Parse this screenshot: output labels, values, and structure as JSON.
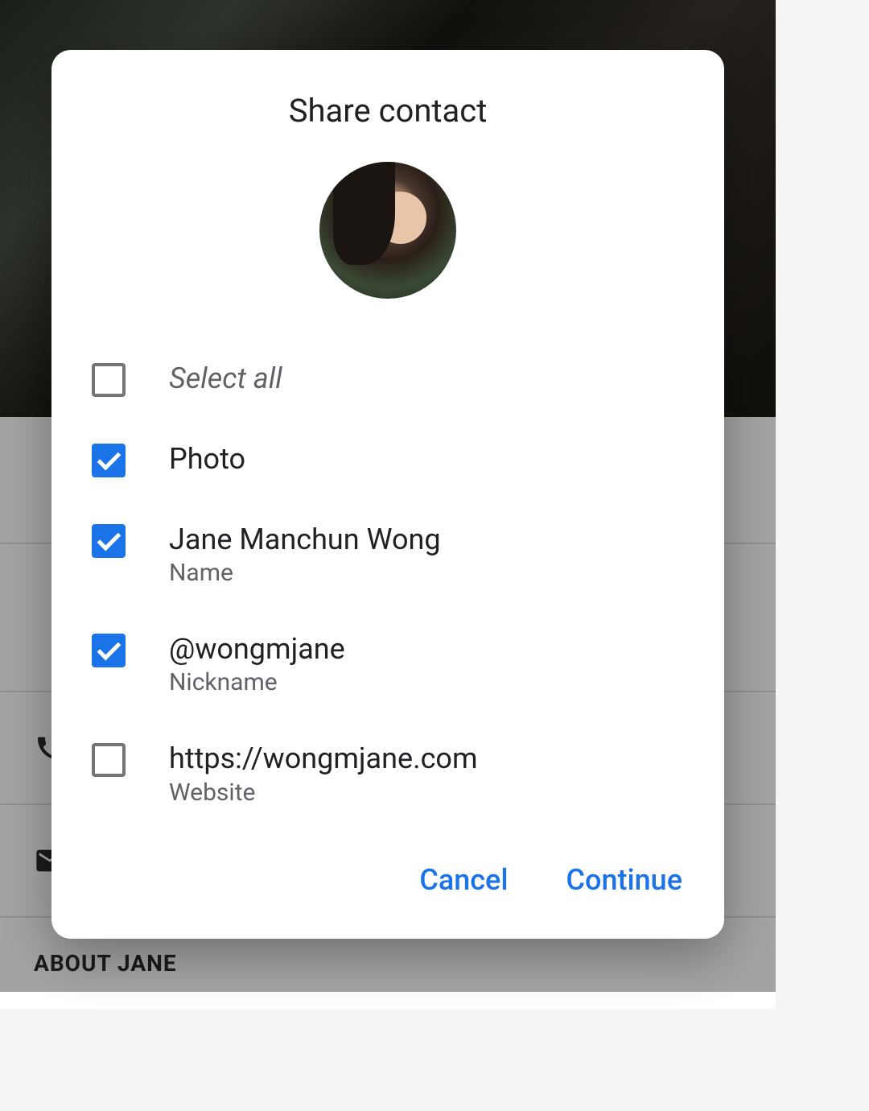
{
  "background": {
    "section_label": "ABOUT JANE"
  },
  "modal": {
    "title": "Share contact",
    "select_all_label": "Select all",
    "items": [
      {
        "primary": "Photo",
        "secondary": null,
        "checked": true
      },
      {
        "primary": "Jane Manchun Wong",
        "secondary": "Name",
        "checked": true
      },
      {
        "primary": "@wongmjane",
        "secondary": "Nickname",
        "checked": true
      },
      {
        "primary": "https://wongmjane.com",
        "secondary": "Website",
        "checked": false
      }
    ],
    "select_all_checked": false,
    "actions": {
      "cancel": "Cancel",
      "continue": "Continue"
    }
  }
}
